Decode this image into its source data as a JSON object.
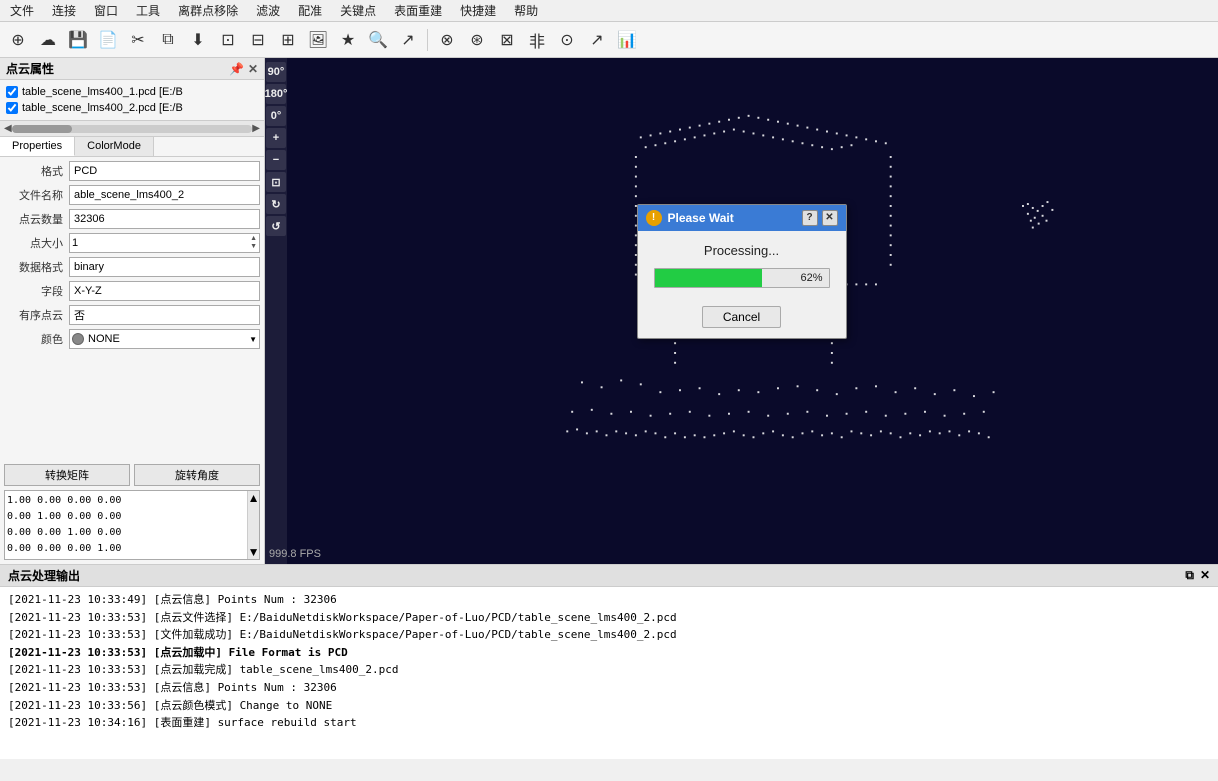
{
  "menubar": {
    "items": [
      "文件",
      "连接",
      "窗口",
      "工具",
      "离群点移除",
      "滤波",
      "配准",
      "关键点",
      "表面重建",
      "快捷建",
      "帮助"
    ]
  },
  "toolbar": {
    "buttons": [
      {
        "name": "open-icon",
        "glyph": "⊕",
        "title": "打开"
      },
      {
        "name": "cloud-icon",
        "glyph": "☁",
        "title": "云"
      },
      {
        "name": "save-icon",
        "glyph": "💾",
        "title": "保存"
      },
      {
        "name": "new-icon",
        "glyph": "📄",
        "title": "新建"
      },
      {
        "name": "cut-icon",
        "glyph": "✂",
        "title": "剪切"
      },
      {
        "name": "copy-icon",
        "glyph": "⧉",
        "title": "复制"
      },
      {
        "name": "download-icon",
        "glyph": "⬇",
        "title": "下载"
      },
      {
        "name": "scan-icon",
        "glyph": "⊡",
        "title": "扫描1"
      },
      {
        "name": "scan2-icon",
        "glyph": "⊟",
        "title": "扫描2"
      },
      {
        "name": "scan3-icon",
        "glyph": "⊞",
        "title": "扫描3"
      },
      {
        "name": "image-icon",
        "glyph": "🖼",
        "title": "图像"
      },
      {
        "name": "star-icon",
        "glyph": "★",
        "title": "收藏"
      },
      {
        "name": "search-icon",
        "glyph": "🔍",
        "title": "搜索"
      },
      {
        "name": "pointer-icon",
        "glyph": "↗",
        "title": "指针"
      },
      {
        "name": "sep1",
        "glyph": "",
        "sep": true
      },
      {
        "name": "link-icon",
        "glyph": "⊗",
        "title": "链接"
      },
      {
        "name": "filter-icon",
        "glyph": "⊛",
        "title": "滤波"
      },
      {
        "name": "rect-icon",
        "glyph": "⊠",
        "title": "矩形"
      },
      {
        "name": "nonrect-icon",
        "glyph": "非",
        "title": "非"
      },
      {
        "name": "circle-icon",
        "glyph": "⊙",
        "title": "圆"
      },
      {
        "name": "chart1-icon",
        "glyph": "↗",
        "title": "图表1"
      },
      {
        "name": "chart2-icon",
        "glyph": "📊",
        "title": "图表2"
      }
    ]
  },
  "left_panel": {
    "title": "点云属性",
    "layers": [
      {
        "checked": true,
        "label": "table_scene_lms400_1.pcd [E:/B"
      },
      {
        "checked": true,
        "label": "table_scene_lms400_2.pcd [E:/B"
      }
    ],
    "tabs": [
      "Properties",
      "ColorMode"
    ],
    "properties": [
      {
        "label": "格式",
        "value": "PCD",
        "type": "text"
      },
      {
        "label": "文件名称",
        "value": "able_scene_lms400_2",
        "type": "text"
      },
      {
        "label": "点云数量",
        "value": "32306",
        "type": "text"
      },
      {
        "label": "点大小",
        "value": "1",
        "type": "spin"
      },
      {
        "label": "数据格式",
        "value": "binary",
        "type": "text"
      },
      {
        "label": "字段",
        "value": "X-Y-Z",
        "type": "text"
      },
      {
        "label": "有序点云",
        "value": "否",
        "type": "text"
      },
      {
        "label": "颜色",
        "value": "NONE",
        "type": "select"
      }
    ],
    "transform_labels": [
      "转换矩阵",
      "旋转角度"
    ],
    "matrix": "1.00 0.00 0.00 0.00\n0.00 1.00 0.00 0.00\n0.00 0.00 1.00 0.00\n0.00 0.00 0.00 1.00"
  },
  "view3d": {
    "fps": "999.8 FPS"
  },
  "side_toolbar": {
    "buttons": [
      {
        "name": "perspective-90",
        "glyph": "90°"
      },
      {
        "name": "perspective-180",
        "glyph": "180°"
      },
      {
        "name": "perspective-0",
        "glyph": "0°"
      },
      {
        "name": "zoom-in",
        "glyph": "+"
      },
      {
        "name": "zoom-out",
        "glyph": "−"
      },
      {
        "name": "fit-icon",
        "glyph": "⊡"
      },
      {
        "name": "rotate-icon",
        "glyph": "↻"
      },
      {
        "name": "reset-icon",
        "glyph": "↺"
      }
    ]
  },
  "dialog": {
    "title": "Please Wait",
    "icon": "!",
    "processing_text": "Processing...",
    "progress_pct": 62,
    "progress_pct_label": "62%",
    "cancel_label": "Cancel"
  },
  "bottom_panel": {
    "title": "点云处理输出",
    "logs": [
      {
        "text": "[2021-11-23 10:33:49] [点云信息] Points Num : 32306",
        "bold": false
      },
      {
        "text": "[2021-11-23 10:33:53] [点云文件选择] E:/BaiduNetdiskWorkspace/Paper-of-Luo/PCD/table_scene_lms400_2.pcd",
        "bold": false
      },
      {
        "text": "[2021-11-23 10:33:53] [文件加载成功] E:/BaiduNetdiskWorkspace/Paper-of-Luo/PCD/table_scene_lms400_2.pcd",
        "bold": false
      },
      {
        "text": "[2021-11-23 10:33:53] [点云加载中] File Format is PCD",
        "bold": true
      },
      {
        "text": "[2021-11-23 10:33:53] [点云加载完成] table_scene_lms400_2.pcd",
        "bold": false
      },
      {
        "text": "[2021-11-23 10:33:53] [点云信息] Points Num : 32306",
        "bold": false
      },
      {
        "text": "[2021-11-23 10:33:56] [点云颜色模式] Change to NONE",
        "bold": false
      },
      {
        "text": "[2021-11-23 10:34:16] [表面重建] surface rebuild start",
        "bold": false
      }
    ]
  }
}
